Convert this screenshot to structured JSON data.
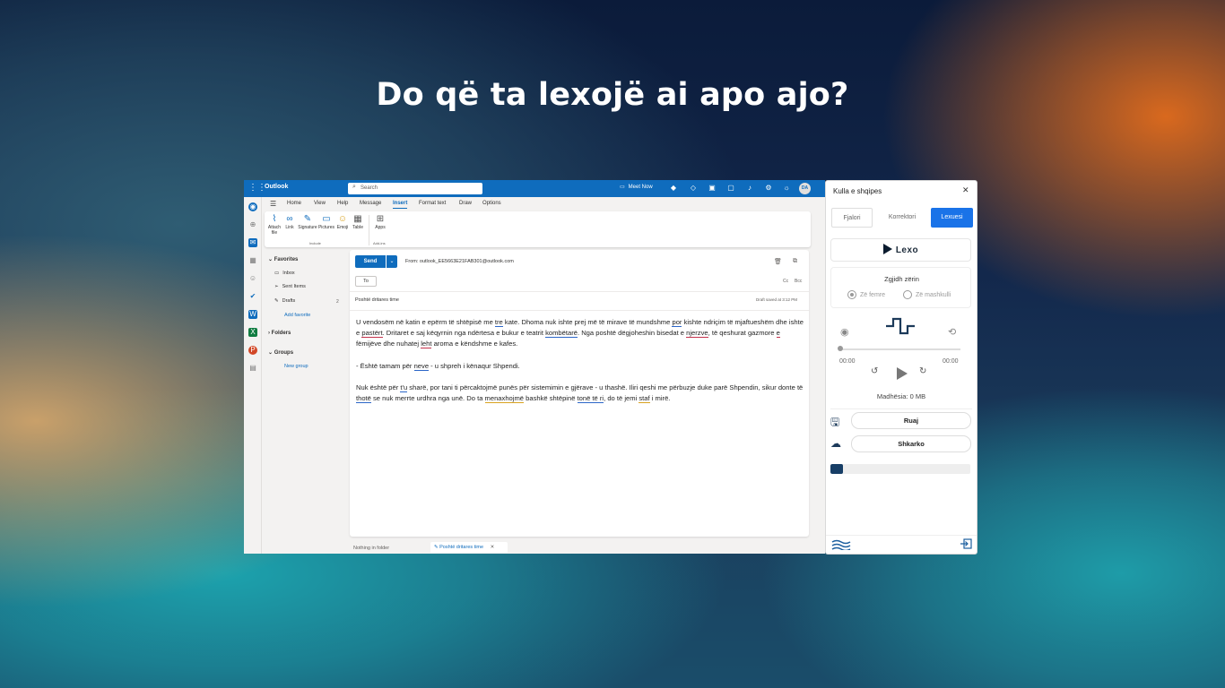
{
  "headline": "Do që ta lexojë ai apo ajo?",
  "outlook": {
    "app_name": "Outlook",
    "search_placeholder": "Search",
    "meet_now": "Meet Now",
    "avatar_initials": "DA",
    "tabs": [
      "Home",
      "View",
      "Help",
      "Message",
      "Insert",
      "Format text",
      "Draw",
      "Options"
    ],
    "active_tab": "Insert",
    "ribbon": {
      "attach": "Attach file",
      "link": "Link",
      "signature": "Signature",
      "pictures": "Pictures",
      "emoji": "Emoji",
      "table": "Table",
      "apps": "Apps",
      "group_include": "Include",
      "group_addins": "Add-ins"
    },
    "folders": {
      "favorites": "Favorites",
      "inbox": "Inbox",
      "sent": "Sent Items",
      "drafts": "Drafts",
      "drafts_count": "2",
      "add_favorite": "Add favorite",
      "folders": "Folders",
      "groups": "Groups",
      "new_group": "New group"
    },
    "compose": {
      "send": "Send",
      "from": "From: outlook_EE5663E21FAB301@outlook.com",
      "to": "To",
      "cc": "Cc",
      "bcc": "Bcc",
      "subject": "Poshtë dritares time",
      "draft_saved": "Draft saved at 3:12 PM"
    },
    "status": {
      "nothing": "Nothing in folder",
      "draft_tab": "Poshtë dritares time"
    }
  },
  "panel": {
    "title": "Kulla e shqipes",
    "tabs": [
      "Fjalori",
      "Korrektori",
      "Lexuesi"
    ],
    "active_tab": "Lexuesi",
    "read_button": "Lexo",
    "voice_label": "Zgjidh zërin",
    "voice_female": "Zë femre",
    "voice_male": "Zë mashkulli",
    "time_start": "00:00",
    "time_end": "00:00",
    "size": "Madhësia: 0 MB",
    "save": "Ruaj",
    "download": "Shkarko",
    "progress": 0.09
  },
  "colors": {
    "outlook_blue": "#0f6cbd",
    "panel_active_tab": "#1a73e8",
    "progress_fill": "#173e66"
  }
}
